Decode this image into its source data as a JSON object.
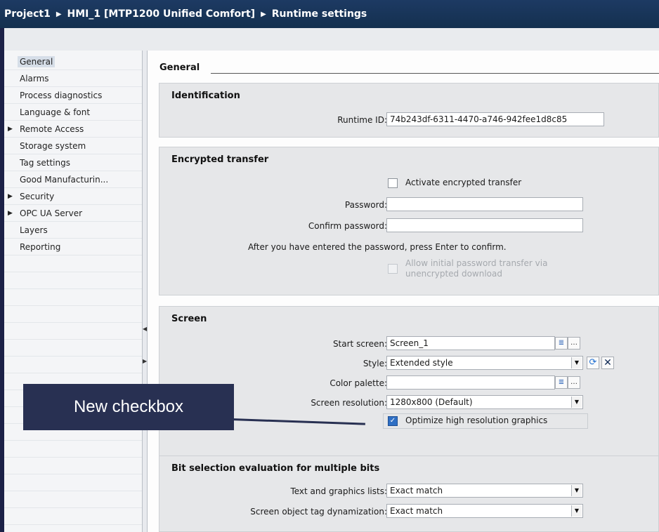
{
  "breadcrumb": {
    "project": "Project1",
    "device": "HMI_1 [MTP1200 Unified Comfort]",
    "page": "Runtime settings",
    "separator": "▶"
  },
  "nav": {
    "items": [
      {
        "label": "General",
        "selected": true,
        "expandable": false
      },
      {
        "label": "Alarms",
        "expandable": false
      },
      {
        "label": "Process diagnostics",
        "expandable": false
      },
      {
        "label": "Language & font",
        "expandable": false
      },
      {
        "label": "Remote Access",
        "expandable": true
      },
      {
        "label": "Storage system",
        "expandable": false
      },
      {
        "label": "Tag settings",
        "expandable": false
      },
      {
        "label": "Good Manufacturin...",
        "expandable": false
      },
      {
        "label": "Security",
        "expandable": true
      },
      {
        "label": "OPC UA Server",
        "expandable": true
      },
      {
        "label": "Layers",
        "expandable": false
      },
      {
        "label": "Reporting",
        "expandable": false
      }
    ]
  },
  "main": {
    "section_title": "General",
    "identification": {
      "title": "Identification",
      "runtime_id_label": "Runtime ID:",
      "runtime_id_value": "74b243df-6311-4470-a746-942fee1d8c85"
    },
    "encrypted": {
      "title": "Encrypted transfer",
      "activate_label": "Activate encrypted transfer",
      "activate_checked": false,
      "password_label": "Password:",
      "password_value": "",
      "confirm_label": "Confirm password:",
      "confirm_value": "",
      "hint": "After you have entered the password, press Enter to confirm.",
      "allow_label_line1": "Allow initial password transfer via",
      "allow_label_line2": "unencrypted download",
      "allow_checked": false
    },
    "screen": {
      "title": "Screen",
      "start_screen_label": "Start screen:",
      "start_screen_value": "Screen_1",
      "style_label": "Style:",
      "style_value": "Extended style",
      "color_palette_label": "Color palette:",
      "color_palette_value": "",
      "resolution_label": "Screen resolution:",
      "resolution_value": "1280x800 (Default)",
      "optimize_label": "Optimize high resolution graphics",
      "optimize_checked": true
    },
    "bitsel": {
      "title": "Bit selection evaluation for multiple bits",
      "text_lists_label": "Text and graphics lists:",
      "text_lists_value": "Exact match",
      "dyn_label": "Screen object tag dynamization:",
      "dyn_value": "Exact match"
    }
  },
  "callout": {
    "text": "New checkbox"
  },
  "colors": {
    "frame": "#1c2147",
    "title_bar": "#14304f",
    "group_bg": "#e6e7e9",
    "checkbox_checked": "#2f6fc4",
    "callout": "#283052"
  }
}
